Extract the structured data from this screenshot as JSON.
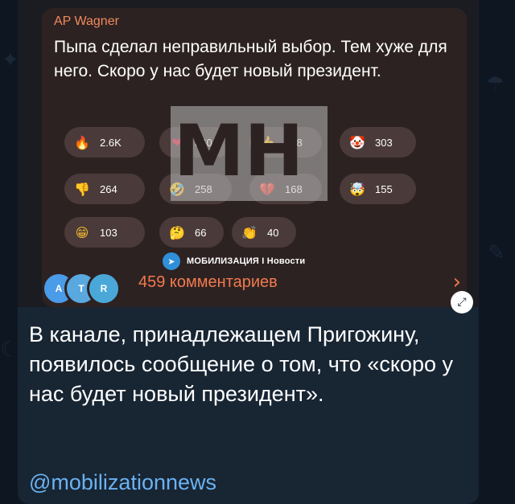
{
  "background": {
    "color": "#0e1621",
    "bubble_color": "#182533"
  },
  "screenshot": {
    "sender": "AP Wagner",
    "quote": "Пыпа сделал неправильный выбор. Тем хуже для него. Скоро у нас будет новый президент.",
    "reactions": [
      {
        "icon": "fire-icon",
        "glyph": "🔥",
        "count": "2.6K",
        "color": "#e0502a"
      },
      {
        "icon": "heart-icon",
        "glyph": "❤",
        "count": "360",
        "color": "#e0253a"
      },
      {
        "icon": "thumbs-up-icon",
        "glyph": "👍",
        "count": "318",
        "color": "#f2b932"
      },
      {
        "icon": "clown-icon",
        "glyph": "🤡",
        "count": "303",
        "color": "#f0f0f0"
      },
      {
        "icon": "thumbs-down-icon",
        "glyph": "👎",
        "count": "264",
        "color": "#f2b932"
      },
      {
        "icon": "rofl-icon",
        "glyph": "🤣",
        "count": "258",
        "color": "#f2b932"
      },
      {
        "icon": "broken-heart-icon",
        "glyph": "💔",
        "count": "168",
        "color": "#e0253a"
      },
      {
        "icon": "exploding-head-icon",
        "glyph": "🤯",
        "count": "155",
        "color": "#f2b932"
      },
      {
        "icon": "grin-icon",
        "glyph": "😁",
        "count": "103",
        "color": "#f2b932"
      },
      {
        "icon": "thinking-icon",
        "glyph": "🤔",
        "count": "66",
        "color": "#f2b932"
      },
      {
        "icon": "clap-icon",
        "glyph": "👏",
        "count": "40",
        "color": "#f2b932"
      }
    ],
    "channel_icon": "telegram-icon",
    "channel_name": "МОБИЛИЗАЦИЯ I Новости",
    "avatars": [
      {
        "letter": "A",
        "color": "#4a9be8"
      },
      {
        "letter": "T",
        "color": "#5aa8e0"
      },
      {
        "letter": "R",
        "color": "#4aa8d8"
      }
    ],
    "comments": "459 комментариев",
    "chevron_icon": "chevron-right-icon",
    "watermark_icon": "watermark-logo-icon",
    "watermark_text": "MH"
  },
  "expand_icon": "expand-icon",
  "message": {
    "text": "В канале, принадлежащем Пригожину, появилось сообщение о том, что «скоро у нас будет новый президент».",
    "link": "@mobilizationnews"
  }
}
